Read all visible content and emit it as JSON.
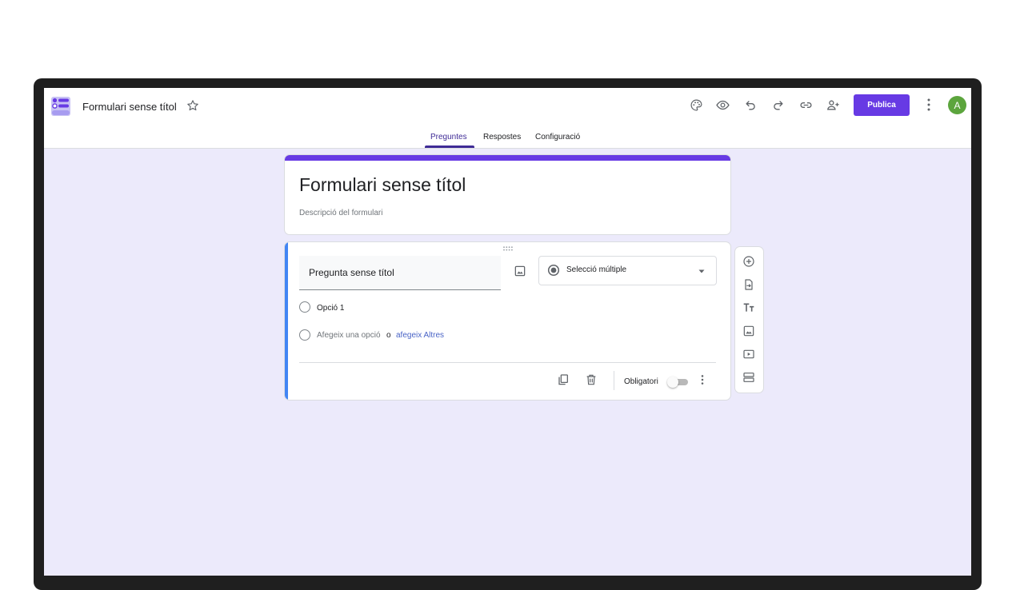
{
  "header": {
    "doc_title": "Formulari sense títol",
    "publish_label": "Publica",
    "avatar_initial": "A",
    "icons": [
      "palette-icon",
      "eye-icon",
      "undo-icon",
      "redo-icon",
      "link-icon",
      "add-collaborator-icon",
      "more-vert-icon"
    ]
  },
  "tabs": [
    {
      "label": "Preguntes",
      "active": true
    },
    {
      "label": "Respostes",
      "active": false
    },
    {
      "label": "Configuració",
      "active": false
    }
  ],
  "form": {
    "title": "Formulari sense títol",
    "description_placeholder": "Descripció del formulari"
  },
  "question": {
    "title": "Pregunta sense títol",
    "type": "Selecció múltiple",
    "options": [
      "Opció 1"
    ],
    "add_option": "Afegeix una opció",
    "or_text": "o",
    "add_other": "afegeix Altres",
    "required_label": "Obligatori",
    "required": false
  },
  "side_toolbar": [
    "add-question-icon",
    "import-questions-icon",
    "add-title-icon",
    "add-image-icon",
    "add-video-icon",
    "add-section-icon"
  ],
  "colors": {
    "accent": "#673ae4",
    "background": "#eceafb",
    "active_tab": "#3f2b96",
    "question_accent": "#4285f4",
    "avatar": "#5ca53d",
    "link": "#4a64c6"
  }
}
